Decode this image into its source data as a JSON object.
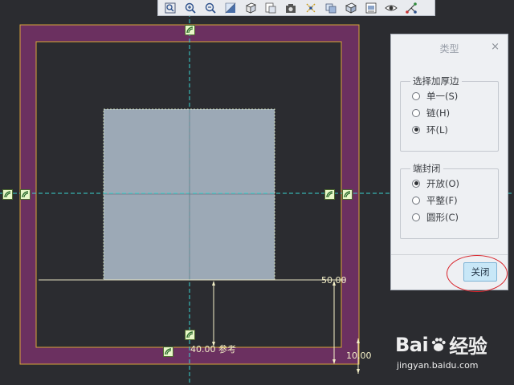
{
  "toolbar": {
    "icons": [
      "zoom-fit-icon",
      "zoom-in-icon",
      "zoom-out-icon",
      "shading-icon",
      "view-orientation-icon",
      "saved-views-icon",
      "display-style-icon",
      "spin-center-icon",
      "datum-display-icon",
      "annotation-icon",
      "view-manager-icon",
      "visibility-icon",
      "axis-display-icon"
    ]
  },
  "dimensions": {
    "width": "50.00",
    "reference": "40.00 参考",
    "thickness": "10.00"
  },
  "panel": {
    "title": "类型",
    "close_glyph": "×",
    "group_edges": {
      "legend": "选择加厚边",
      "options": [
        "单一(S)",
        "链(H)",
        "环(L)"
      ],
      "selected_index": 2
    },
    "group_end": {
      "legend": "端封闭",
      "options": [
        "开放(O)",
        "平整(F)",
        "圆形(C)"
      ],
      "selected_index": 0
    },
    "close_button": "关闭"
  },
  "watermark": {
    "main_left": "Bai",
    "main_right": "经验",
    "sub": "jingyan.baidu.com"
  },
  "colors": {
    "background": "#2b2c30",
    "frame": "#6b3060",
    "sketch_fill": "#9ca9b6",
    "accent_red": "#d8232a",
    "centerline": "#38d4d0",
    "dimension": "#f4f0c8"
  }
}
